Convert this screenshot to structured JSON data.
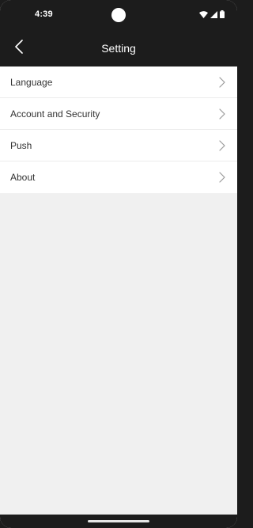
{
  "status_bar": {
    "time": "4:39",
    "icons": [
      "wifi-icon",
      "signal-icon",
      "battery-icon"
    ]
  },
  "app_bar": {
    "title": "Setting",
    "back_icon": "back-arrow-icon"
  },
  "settings": {
    "items": [
      {
        "label": "Language"
      },
      {
        "label": "Account and Security"
      },
      {
        "label": "Push"
      },
      {
        "label": "About"
      }
    ],
    "chevron_icon": "chevron-right-icon"
  },
  "colors": {
    "bar_background": "#1c1c1c",
    "page_background": "#f0f0f0",
    "list_background": "#ffffff",
    "text": "#333333",
    "chevron": "#9a9a9a"
  }
}
